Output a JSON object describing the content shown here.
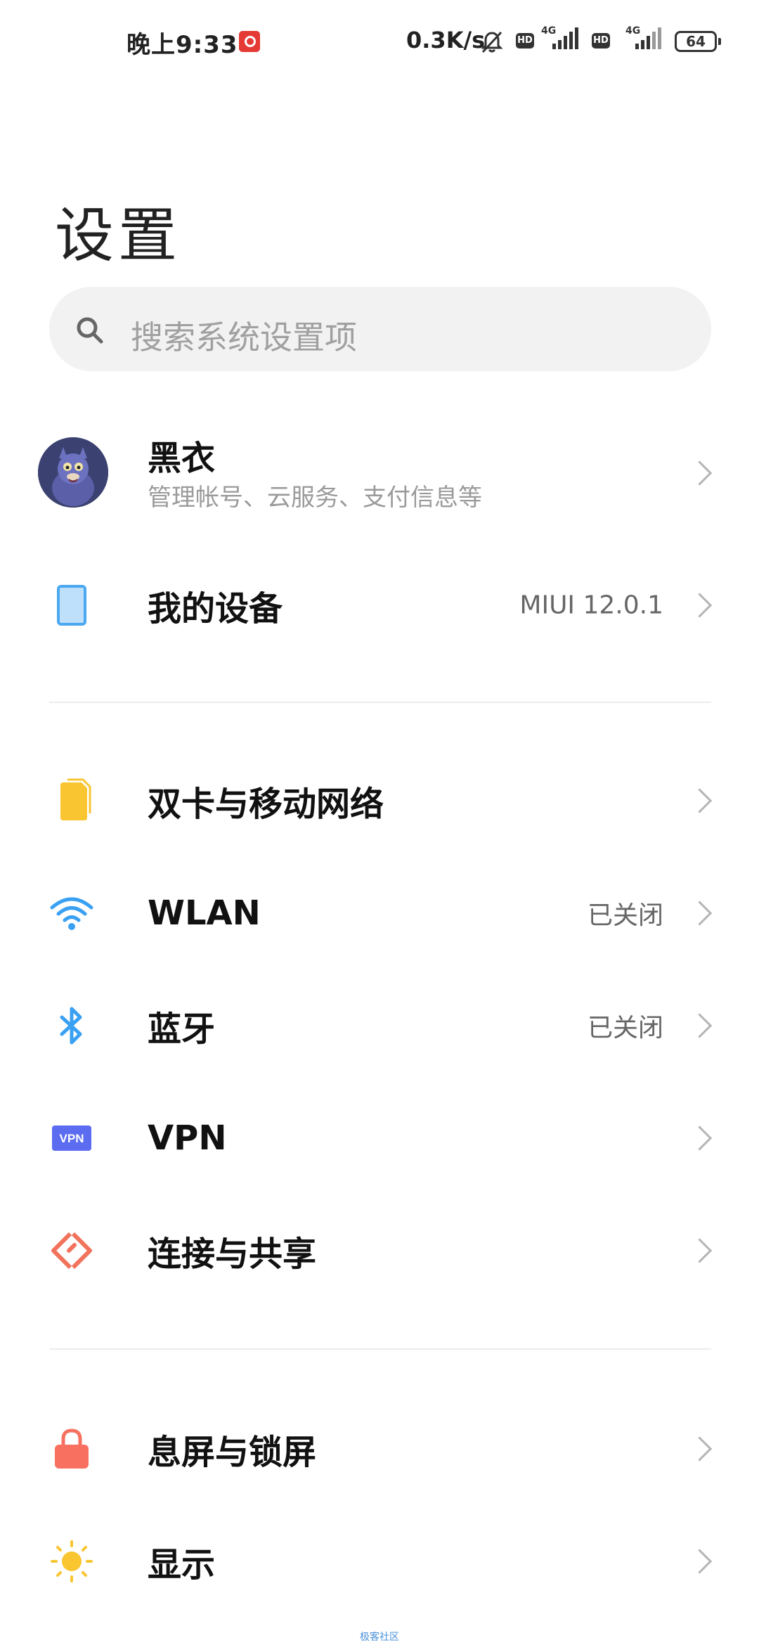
{
  "status_bar": {
    "time": "晚上9:33",
    "net_speed": "0.3K/s",
    "hd_badge": "HD",
    "network_type": "4G",
    "battery": "64",
    "icons": [
      "netease-music-icon",
      "bell-muted-icon",
      "signal-icon",
      "battery-icon"
    ]
  },
  "title": "设置",
  "search": {
    "placeholder": "搜索系统设置项"
  },
  "account": {
    "name": "黑衣",
    "subtitle": "管理帐号、云服务、支付信息等"
  },
  "device": {
    "label": "我的设备",
    "value": "MIUI 12.0.1"
  },
  "sections": {
    "network": [
      {
        "label": "双卡与移动网络",
        "value": "",
        "icon": "sim-card-icon"
      },
      {
        "label": "WLAN",
        "value": "已关闭",
        "icon": "wifi-icon"
      },
      {
        "label": "蓝牙",
        "value": "已关闭",
        "icon": "bluetooth-icon"
      },
      {
        "label": "VPN",
        "value": "",
        "icon": "vpn-icon"
      },
      {
        "label": "连接与共享",
        "value": "",
        "icon": "share-icon"
      }
    ],
    "display": [
      {
        "label": "息屏与锁屏",
        "value": "",
        "icon": "lock-icon"
      },
      {
        "label": "显示",
        "value": "",
        "icon": "sun-icon"
      }
    ]
  },
  "vpn_icon_text": "VPN",
  "watermark": "极客社区",
  "colors": {
    "device_icon": "#4aa8f0",
    "sim_icon": "#f9c531",
    "wifi_icon": "#3aa0f2",
    "bluetooth_icon": "#3aa0f2",
    "vpn_icon": "#5b6cf0",
    "share_icon": "#f2735c",
    "lock_icon": "#f77060",
    "sun_icon": "#f9c531"
  }
}
